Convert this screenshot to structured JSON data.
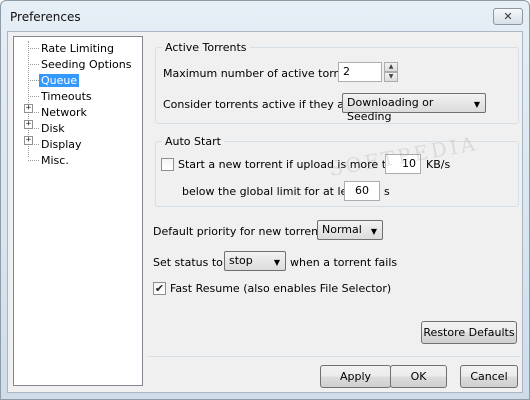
{
  "window": {
    "title": "Preferences",
    "close_glyph": "✕"
  },
  "tree": [
    {
      "label": "Rate Limiting",
      "expandable": false
    },
    {
      "label": "Seeding Options",
      "expandable": false
    },
    {
      "label": "Queue",
      "expandable": false,
      "selected": true
    },
    {
      "label": "Timeouts",
      "expandable": false
    },
    {
      "label": "Network",
      "expandable": true
    },
    {
      "label": "Disk",
      "expandable": true
    },
    {
      "label": "Display",
      "expandable": true
    },
    {
      "label": "Misc.",
      "expandable": false
    }
  ],
  "active_torrents": {
    "title": "Active Torrents",
    "max_label": "Maximum number of active torrents",
    "max_value": "2",
    "consider_label": "Consider torrents active if they are:",
    "consider_value": "Downloading or Seeding"
  },
  "auto_start": {
    "title": "Auto Start",
    "checkbox_label": "Start a new torrent if upload is more than",
    "checked": false,
    "upload_value": "10",
    "upload_unit": "KB/s",
    "below_label": "below the global limit for at least",
    "seconds_value": "60",
    "seconds_unit": "s"
  },
  "default_priority": {
    "label": "Default priority for new torrents:",
    "value": "Normal"
  },
  "set_status": {
    "label": "Set status to:",
    "value": "stop",
    "suffix": "when a torrent fails"
  },
  "fast_resume": {
    "label": "Fast Resume (also enables File Selector)",
    "checked": true
  },
  "buttons": {
    "restore": "Restore Defaults",
    "apply": "Apply",
    "ok": "OK",
    "cancel": "Cancel"
  },
  "watermark": "SOFTPEDIA",
  "icons": {
    "expander": "plus-box",
    "combo_arrow": "▼",
    "spin_up": "▲",
    "spin_down": "▼",
    "check": "✔"
  }
}
